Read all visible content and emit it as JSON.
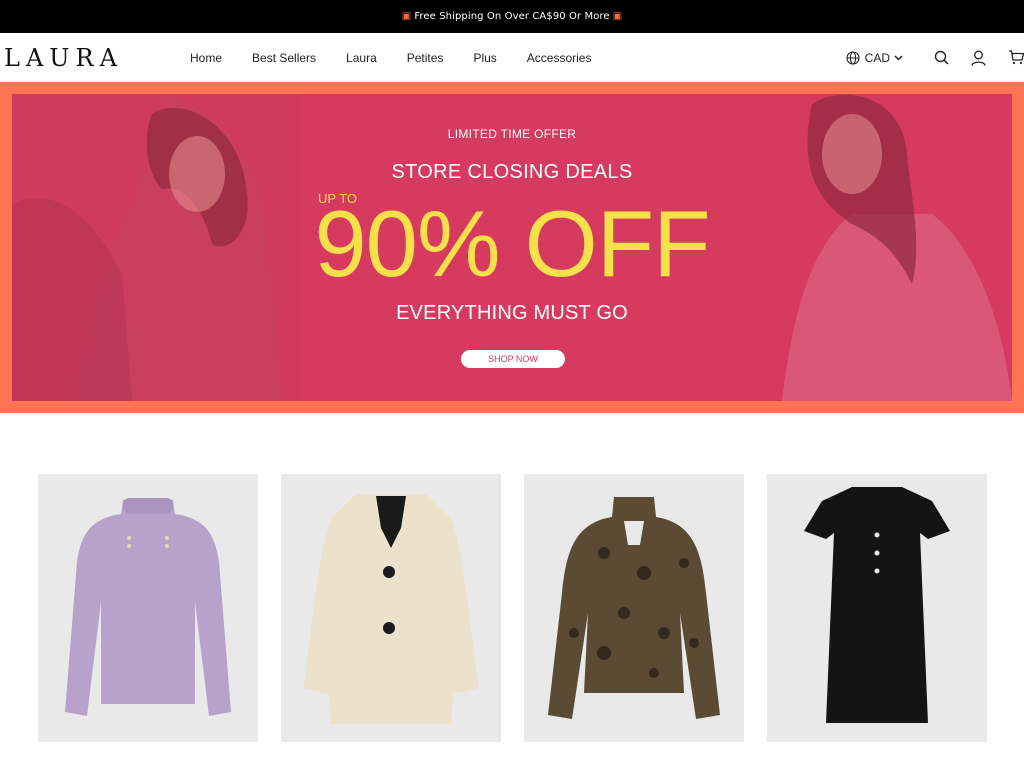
{
  "announcement": {
    "text": "Free Shipping On Over CA$90 Or More",
    "icon": "gift-icon",
    "icon_color": "#ff6a3c"
  },
  "header": {
    "logo": "LAURA",
    "nav": [
      {
        "label": "Home"
      },
      {
        "label": "Best Sellers"
      },
      {
        "label": "Laura"
      },
      {
        "label": "Petites"
      },
      {
        "label": "Plus"
      },
      {
        "label": "Accessories"
      }
    ],
    "currency": "CAD",
    "icons": [
      "globe-icon",
      "chevron-down-icon",
      "search-icon",
      "account-icon",
      "cart-icon"
    ]
  },
  "hero": {
    "limited": "LIMITED TIME OFFER",
    "headline": "STORE CLOSING DEALS",
    "up_to": "UP TO",
    "offer": "90% OFF",
    "subline": "EVERYTHING MUST GO",
    "cta": "SHOP NOW",
    "colors": {
      "frame": "#ff7355",
      "panel": "#d63a5e",
      "accent": "#f7e04a"
    }
  },
  "products": [
    {
      "name": "Lilac sweater",
      "icon": "sweater-image"
    },
    {
      "name": "Cream teddy coat",
      "icon": "coat-image"
    },
    {
      "name": "Leopard print blouse",
      "icon": "blouse-image"
    },
    {
      "name": "Black dress",
      "icon": "dress-image"
    }
  ]
}
